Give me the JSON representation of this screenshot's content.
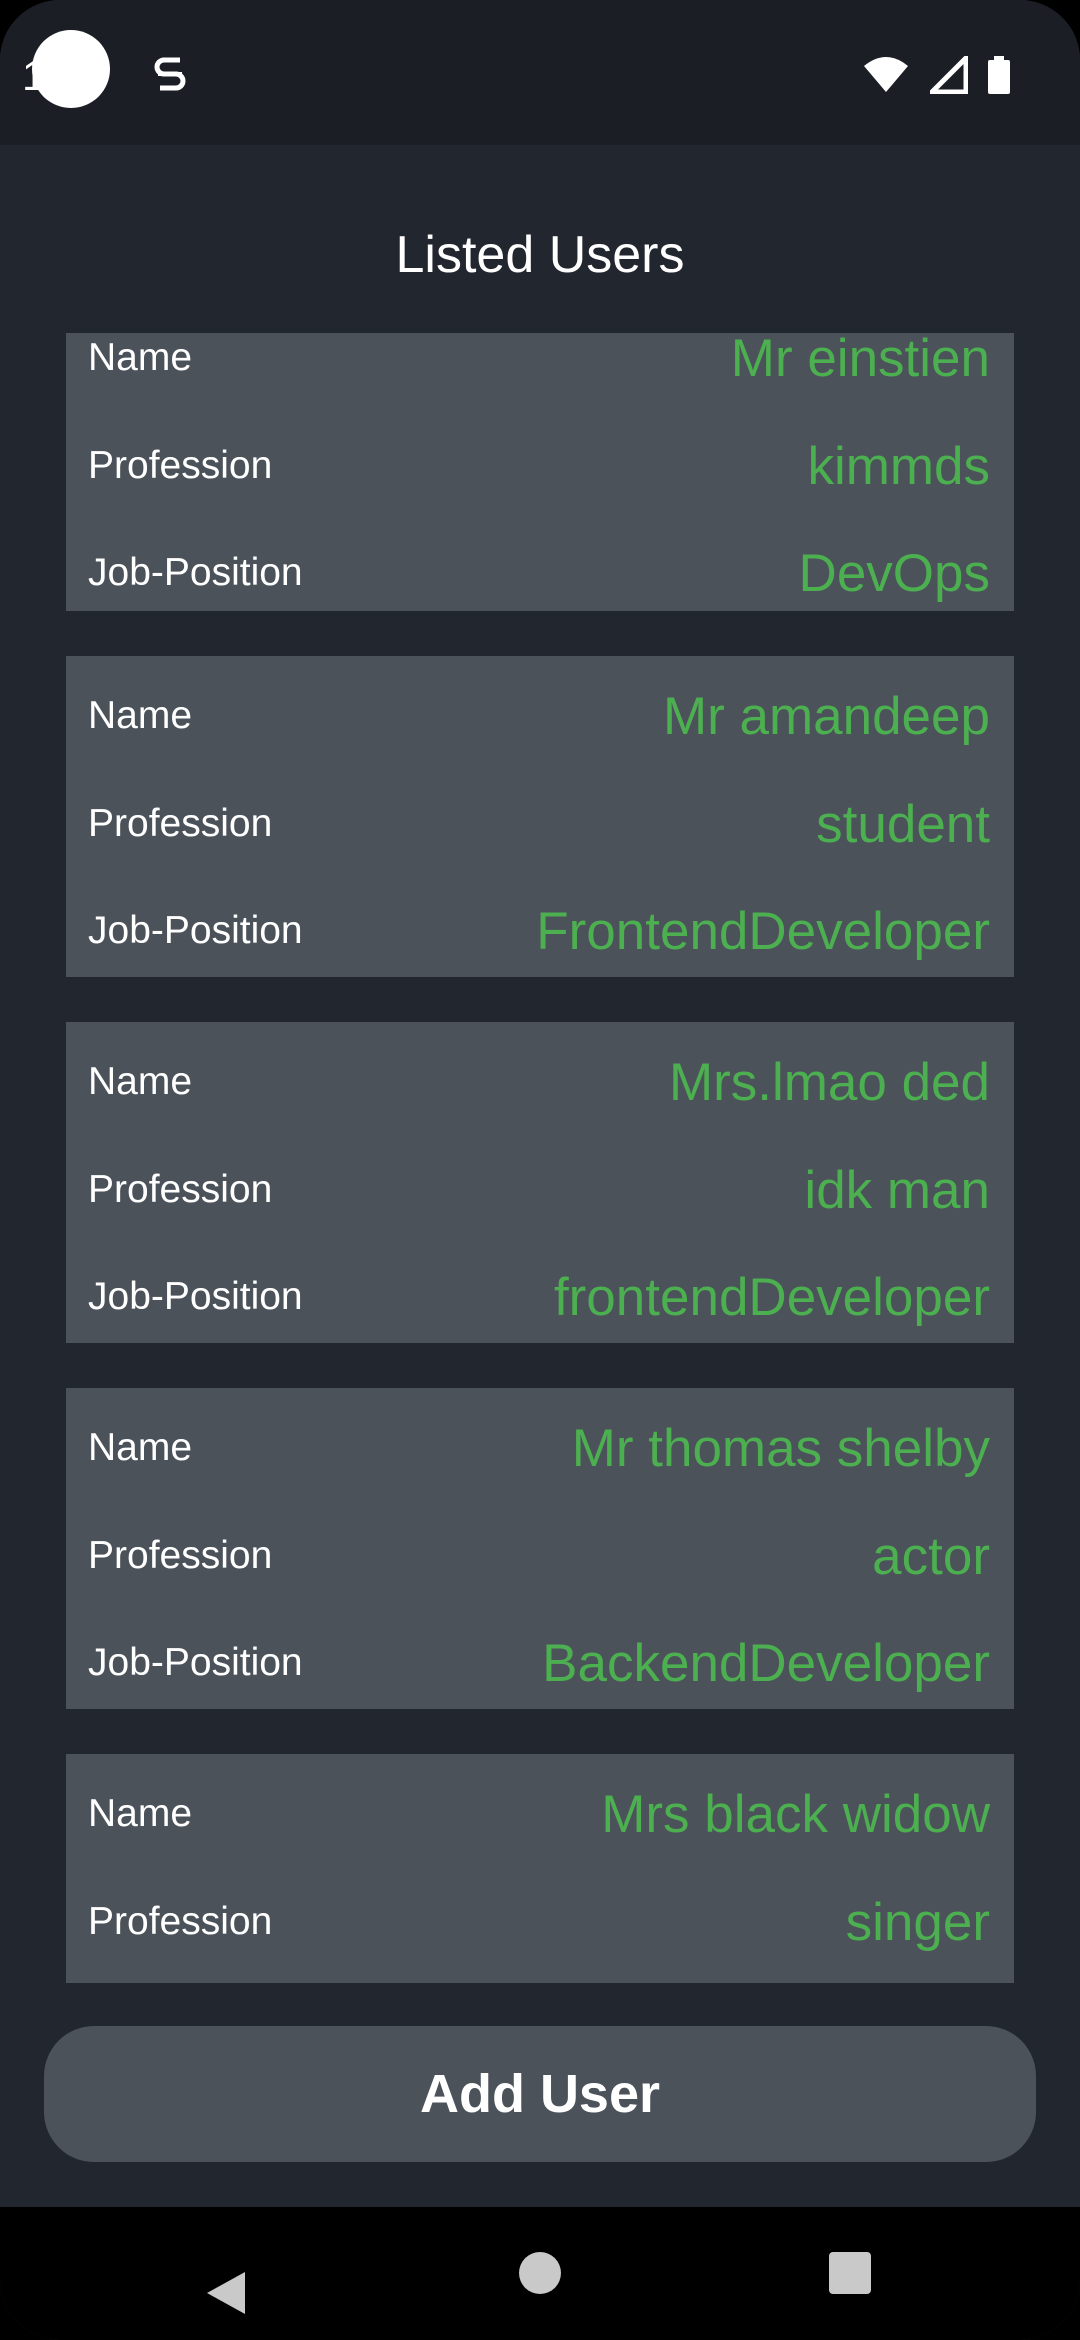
{
  "status_bar": {
    "time": "1:03",
    "icons": [
      "sim-s-icon",
      "wifi-icon",
      "signal-icon",
      "battery-icon"
    ]
  },
  "title": "Listed Users",
  "labels": {
    "name": "Name",
    "profession": "Profession",
    "job_position": "Job-Position"
  },
  "users": [
    {
      "name": "Mr einstien",
      "profession": "kimmds",
      "job_position": "DevOps"
    },
    {
      "name": "Mr amandeep",
      "profession": "student",
      "job_position": "FrontendDeveloper"
    },
    {
      "name": "Mrs.lmao ded",
      "profession": "idk man",
      "job_position": "frontendDeveloper"
    },
    {
      "name": "Mr thomas shelby",
      "profession": "actor",
      "job_position": "BackendDeveloper"
    },
    {
      "name": "Mrs black widow",
      "profession": "singer",
      "job_position": ""
    }
  ],
  "add_button_label": "Add User",
  "colors": {
    "background": "#22262f",
    "card": "#4b525a",
    "value_text": "#4caf50",
    "label_text": "#ffffff"
  },
  "nav_icons": [
    "back-icon",
    "home-icon",
    "recents-icon"
  ]
}
